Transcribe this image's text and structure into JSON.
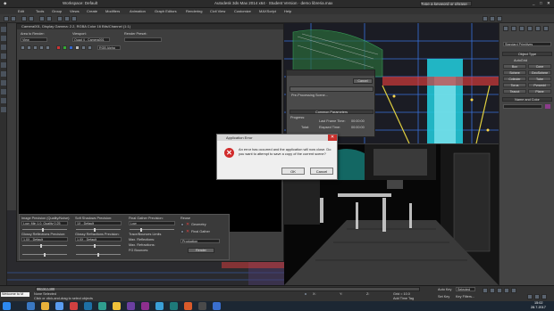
{
  "titlebar": {
    "workspace": "Workspace: Default",
    "title": "Autodesk 3ds Max 2014 x64 · Student Version · demo libreria.max",
    "search_placeholder": "Type a keyword or phrase"
  },
  "menubar": {
    "items": [
      "Edit",
      "Tools",
      "Group",
      "Views",
      "Create",
      "Modifiers",
      "Animation",
      "Graph Editors",
      "Rendering",
      "Civil View",
      "Customize",
      "MAXScript",
      "Help"
    ]
  },
  "frame_buffer": {
    "title": "Camera001, Display Gamma: 2.2, RGBA Color 16 Bits/Channel (1:1)",
    "area_to_render_label": "Area to Render:",
    "area_to_render_value": "View",
    "viewport_label": "Viewport:",
    "viewport_value": "Quad 4 - Camera001",
    "render_preset_label": "Render Preset:",
    "render_preset_value": "",
    "channel_value": "RGB Alpha",
    "image_precision_label": "Image Precision (Quality/Noise):",
    "image_precision_value": "Low: Min 1.0, Quality 0.25",
    "soft_shadows_label": "Soft Shadows Precision:",
    "soft_shadows_value": "1X - Default",
    "final_gather_label": "Final Gather Precision:",
    "final_gather_value": "Low",
    "glossy_reflections_label": "Glossy Reflections Precision:",
    "glossy_reflections_value": "1.0X - Default",
    "glossy_refractions_label": "Glossy Refractions Precision:",
    "glossy_refractions_value": "1.0X - Default",
    "trace_bounces_label": "Trace/Bounces Limits",
    "max_reflections_label": "Max. Reflections:",
    "max_refractions_label": "Max. Refractions:",
    "fg_bounces_label": "FG Bounces:",
    "reuse_label": "Reuse",
    "geometry_label": "Geometry",
    "final_gather_check": "Final Gather",
    "production_value": "Production",
    "render_button": "Render"
  },
  "render_setup": {
    "cancel": "Cancel",
    "pre_processing": "Pre-Processing Scene...",
    "common_parameters": "Common Parameters",
    "progress_label": "Progress:",
    "last_frame_label": "Last Frame Time:",
    "last_frame_value": "00:00:00",
    "elapsed_label": "Elapsed Time:",
    "elapsed_value": "00:00:00",
    "total_label": "Total:"
  },
  "error_dialog": {
    "title": "Application Error",
    "message": "An error has occurred and the application will now close. Do you want to attempt to save a copy of the current scene?",
    "ok": "OK",
    "cancel": "Cancel"
  },
  "command_panel": {
    "dropdown": "Standard Primitives",
    "object_type": "Object Type",
    "autogrid": "AutoGrid",
    "primitives": [
      "Box",
      "Cone",
      "Sphere",
      "GeoSphere",
      "Cylinder",
      "Tube",
      "Torus",
      "Pyramid",
      "Teapot",
      "Plane"
    ],
    "name_and_color": "Name and Color"
  },
  "status": {
    "frame": "0 / 100",
    "listener": "Welcome to M",
    "selection": "None Selected",
    "hint": "Click or click-and-drag to select objects",
    "add_time_tag": "Add Time Tag",
    "autokey": "Auto Key",
    "selected": "Selected",
    "set_key": "Set Key",
    "key_filters": "Key Filters...",
    "x_label": "X:",
    "y_label": "Y:",
    "z_label": "Z:",
    "grid": "Grid = 10.0"
  },
  "taskbar": {
    "time": "15:02",
    "date": "28.7.2017"
  },
  "colors": {
    "error_red": "#d12b2b",
    "viewport_cyan": "#22c6d6"
  }
}
